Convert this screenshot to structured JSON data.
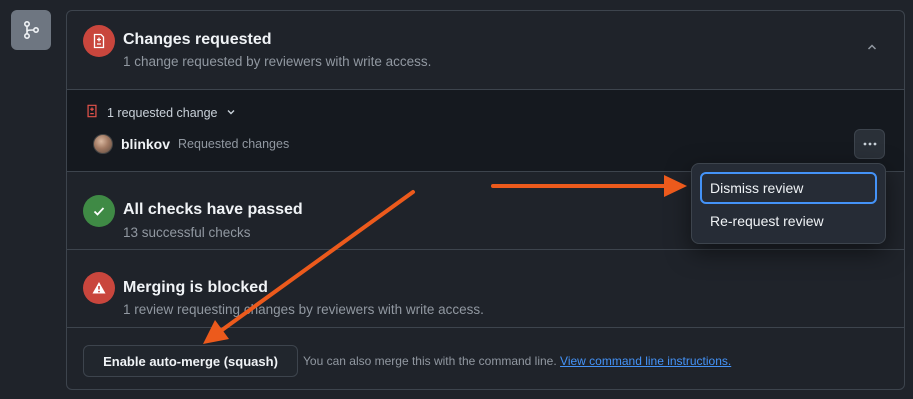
{
  "colors": {
    "danger": "#c9463d",
    "success": "#3f8a45",
    "accent": "#4493f8",
    "annotation_arrow": "#ec5a1c"
  },
  "sidebar": {
    "icon": "git-branch-icon"
  },
  "changes_requested": {
    "icon": "file-diff-icon",
    "title": "Changes requested",
    "subtitle": "1 change requested by reviewers with write access.",
    "collapse_icon": "chevron-up-icon"
  },
  "requested_changes": {
    "icon": "file-diff-icon",
    "toggle_label": "1 requested change",
    "reviewer": {
      "name": "blinkov",
      "status": "Requested changes"
    },
    "more_icon": "kebab-horizontal-icon"
  },
  "review_menu": {
    "items": [
      {
        "label": "Dismiss review"
      },
      {
        "label": "Re-request review"
      }
    ]
  },
  "checks": {
    "icon": "check-icon",
    "title": "All checks have passed",
    "subtitle": "13 successful checks"
  },
  "blocked": {
    "icon": "alert-icon",
    "title": "Merging is blocked",
    "subtitle": "1 review requesting changes by reviewers with write access."
  },
  "merge": {
    "button_label": "Enable auto-merge (squash)",
    "hint": "You can also merge this with the command line.",
    "link": "View command line instructions."
  }
}
